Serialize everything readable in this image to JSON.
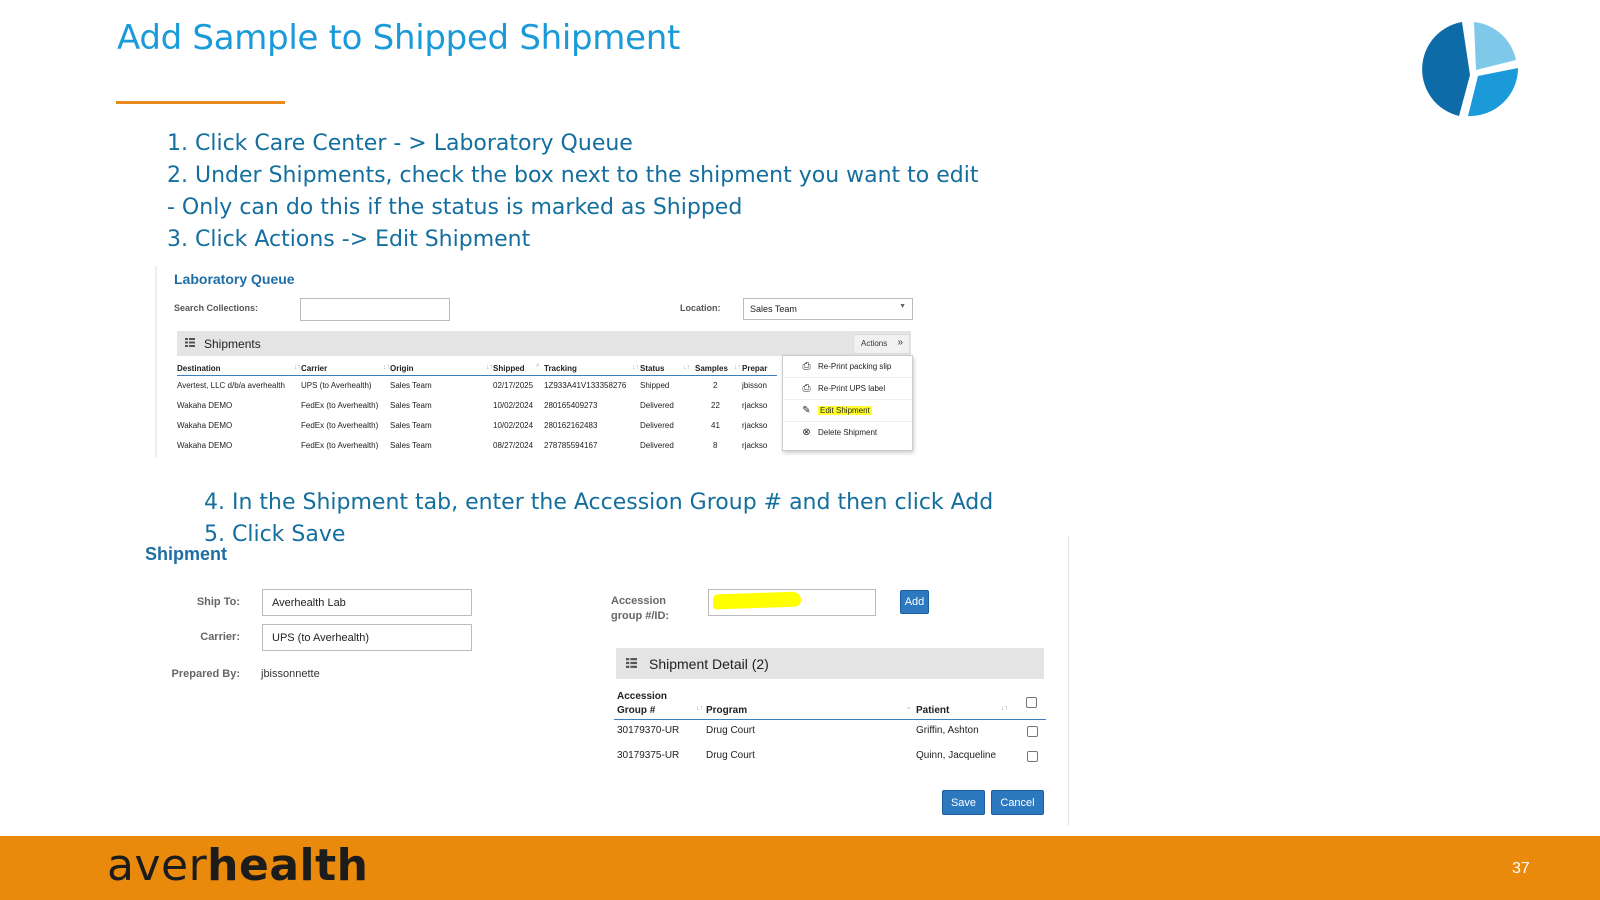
{
  "slide": {
    "title": "Add Sample to Shipped Shipment",
    "page_number": "37",
    "brand_light": "aver",
    "brand_bold": "health",
    "colors": {
      "title": "#1a9ad9",
      "steps": "#146e9e",
      "accent": "#e98a0c",
      "ui_blue": "#2d79c0"
    }
  },
  "steps_top": [
    "1. Click Care Center - > Laboratory Queue",
    "2. Under Shipments, check the box next to the shipment you want to edit",
    "- Only can do this if the status is marked as Shipped",
    "3. Click Actions -> Edit Shipment"
  ],
  "steps_bottom": [
    "4. In the Shipment tab, enter the Accession Group # and then click Add",
    "5. Click Save"
  ],
  "lab_queue": {
    "title": "Laboratory Queue",
    "search_label": "Search Collections:",
    "search_value": "",
    "location_label": "Location:",
    "location_value": "Sales Team",
    "shipments_title": "Shipments",
    "actions_label": "Actions",
    "columns": [
      "Destination",
      "Carrier",
      "Origin",
      "Shipped",
      "Tracking",
      "Status",
      "Samples",
      "Prepar"
    ],
    "rows": [
      [
        "Avertest, LLC d/b/a averhealth",
        "UPS (to Averhealth)",
        "Sales Team",
        "02/17/2025",
        "1Z933A41V133358276",
        "Shipped",
        "2",
        "jbisson"
      ],
      [
        "Wakaha DEMO",
        "FedEx (to Averhealth)",
        "Sales Team",
        "10/02/2024",
        "280165409273",
        "Delivered",
        "22",
        "rjackso"
      ],
      [
        "Wakaha DEMO",
        "FedEx (to Averhealth)",
        "Sales Team",
        "10/02/2024",
        "280162162483",
        "Delivered",
        "41",
        "rjackso"
      ],
      [
        "Wakaha DEMO",
        "FedEx (to Averhealth)",
        "Sales Team",
        "08/27/2024",
        "278785594167",
        "Delivered",
        "8",
        "rjackso"
      ]
    ],
    "actions_menu": [
      "Re-Print packing slip",
      "Re-Print UPS label",
      "Edit Shipment",
      "Delete Shipment"
    ]
  },
  "shipment_form": {
    "title": "Shipment",
    "ship_to_label": "Ship To:",
    "ship_to_value": "Averhealth Lab",
    "carrier_label": "Carrier:",
    "carrier_value": "UPS (to Averhealth)",
    "prepared_by_label": "Prepared By:",
    "prepared_by_value": "jbissonnette",
    "accession_label_line1": "Accession",
    "accession_label_line2": "group #/ID:",
    "add_label": "Add",
    "detail_title": "Shipment Detail (2)",
    "columns": {
      "accession_line1": "Accession",
      "accession_line2": "Group #",
      "program": "Program",
      "patient": "Patient"
    },
    "rows": [
      {
        "accession": "30179370-UR",
        "program": "Drug Court",
        "patient": "Griffin, Ashton"
      },
      {
        "accession": "30179375-UR",
        "program": "Drug Court",
        "patient": "Quinn, Jacqueline"
      }
    ],
    "save_label": "Save",
    "cancel_label": "Cancel"
  }
}
